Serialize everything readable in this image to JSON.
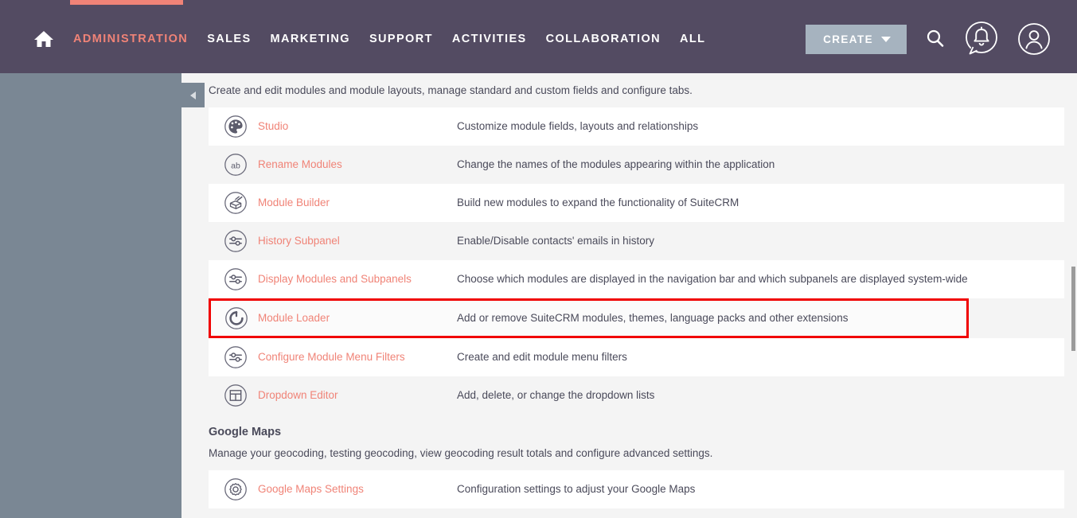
{
  "navbar": {
    "home_icon": "home-icon",
    "links": [
      {
        "label": "ADMINISTRATION",
        "active": true
      },
      {
        "label": "SALES",
        "active": false
      },
      {
        "label": "MARKETING",
        "active": false
      },
      {
        "label": "SUPPORT",
        "active": false
      },
      {
        "label": "ACTIVITIES",
        "active": false
      },
      {
        "label": "COLLABORATION",
        "active": false
      },
      {
        "label": "ALL",
        "active": false
      }
    ],
    "create_label": "CREATE",
    "search_icon": "search-icon",
    "notifications_icon": "notification-bell-icon",
    "profile_icon": "user-profile-icon",
    "accent_color": "#f08377",
    "bar_color": "#534b62"
  },
  "sidebar": {
    "collapse_icon": "chevron-left-icon",
    "background_color": "#7a8794"
  },
  "main": {
    "section_description": "Create and edit modules and module layouts, manage standard and custom fields and configure tabs.",
    "rows": [
      {
        "icon": "palette-icon",
        "label": "Studio",
        "description": "Customize module fields, layouts and relationships",
        "shade": "white",
        "highlighted": false
      },
      {
        "icon": "ab-text-icon",
        "label": "Rename Modules",
        "description": "Change the names of the modules appearing within the application",
        "shade": "gray",
        "highlighted": false
      },
      {
        "icon": "module-builder-icon",
        "label": "Module Builder",
        "description": "Build new modules to expand the functionality of SuiteCRM",
        "shade": "white",
        "highlighted": false
      },
      {
        "icon": "sliders-icon",
        "label": "History Subpanel",
        "description": "Enable/Disable contacts' emails in history",
        "shade": "gray",
        "highlighted": false
      },
      {
        "icon": "sliders-icon",
        "label": "Display Modules and Subpanels",
        "description": "Choose which modules are displayed in the navigation bar and which subpanels are displayed system-wide",
        "shade": "white",
        "highlighted": false
      },
      {
        "icon": "loader-circle-icon",
        "label": "Module Loader",
        "description": "Add or remove SuiteCRM modules, themes, language packs and other extensions",
        "shade": "gray",
        "highlighted": true
      },
      {
        "icon": "sliders-icon",
        "label": "Configure Module Menu Filters",
        "description": "Create and edit module menu filters",
        "shade": "white",
        "highlighted": false
      },
      {
        "icon": "table-layout-icon",
        "label": "Dropdown Editor",
        "description": "Add, delete, or change the dropdown lists",
        "shade": "gray",
        "highlighted": false
      }
    ],
    "google_maps_group": {
      "title": "Google Maps",
      "description": "Manage your geocoding, testing geocoding, view geocoding result totals and configure advanced settings.",
      "rows": [
        {
          "icon": "gear-target-icon",
          "label": "Google Maps Settings",
          "description": "Configuration settings to adjust your Google Maps",
          "shade": "white",
          "highlighted": false
        }
      ]
    }
  },
  "scrollbar": {
    "name": "vertical-scrollbar",
    "thumb_color": "#9b9b9b"
  },
  "colors": {
    "link": "#f08377",
    "text": "#4a4a5a",
    "highlight_border": "#f00000",
    "page_bg": "#f4f4f4"
  }
}
